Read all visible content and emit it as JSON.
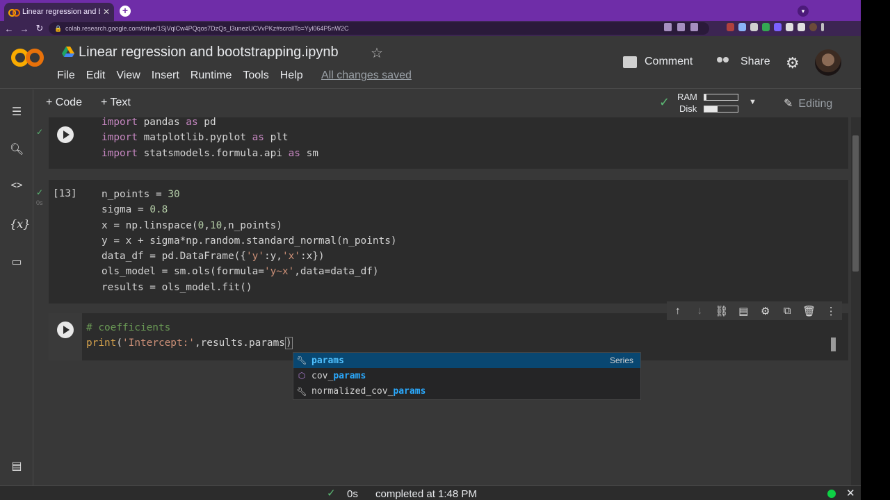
{
  "browser": {
    "tab_title": "Linear regression and bootstrap",
    "tab_close": "✕",
    "url": "colab.research.google.com/drive/1SjVqlCw4PQqos7DzQs_l3unezUCVvPKz#scrollTo=Yyl064P5nW2C"
  },
  "header": {
    "notebook_title": "Linear regression and bootstrapping.ipynb",
    "menu": [
      "File",
      "Edit",
      "View",
      "Insert",
      "Runtime",
      "Tools",
      "Help"
    ],
    "save_status": "All changes saved",
    "comment_label": "Comment",
    "share_label": "Share"
  },
  "toolbar": {
    "add_code": "+ Code",
    "add_text": "+ Text",
    "ram_label": "RAM",
    "disk_label": "Disk",
    "ram_fraction": 0.06,
    "disk_fraction": 0.4,
    "editing_label": "Editing"
  },
  "cells": [
    {
      "exec_count": "",
      "lines": [
        "import pandas as pd",
        "import matplotlib.pyplot as plt",
        "import statsmodels.formula.api as sm"
      ]
    },
    {
      "exec_count": "[13]",
      "run_time": "0s",
      "lines": [
        "n_points = 30",
        "sigma = 0.8",
        "x = np.linspace(0,10,n_points)",
        "y = x + sigma*np.random.standard_normal(n_points)",
        "data_df = pd.DataFrame({'y':y,'x':x})",
        "ols_model = sm.ols(formula='y~x',data=data_df)",
        "results = ols_model.fit()"
      ]
    },
    {
      "exec_count": "",
      "lines": [
        "# coefficients",
        "print('Intercept:',results.params)"
      ]
    }
  ],
  "autocomplete": {
    "items": [
      {
        "prefix": "",
        "match": "params",
        "type": "Series",
        "icon": "wrench-icon"
      },
      {
        "prefix": "cov_",
        "match": "params",
        "type": "",
        "icon": "cube-icon"
      },
      {
        "prefix": "normalized_cov_",
        "match": "params",
        "type": "",
        "icon": "wrench-icon"
      }
    ]
  },
  "statusbar": {
    "elapsed": "0s",
    "completed": "completed at 1:48 PM"
  },
  "colors": {
    "accent_green": "#5bb974",
    "browser_purple": "#6f2da8",
    "selection_blue": "#094771"
  }
}
